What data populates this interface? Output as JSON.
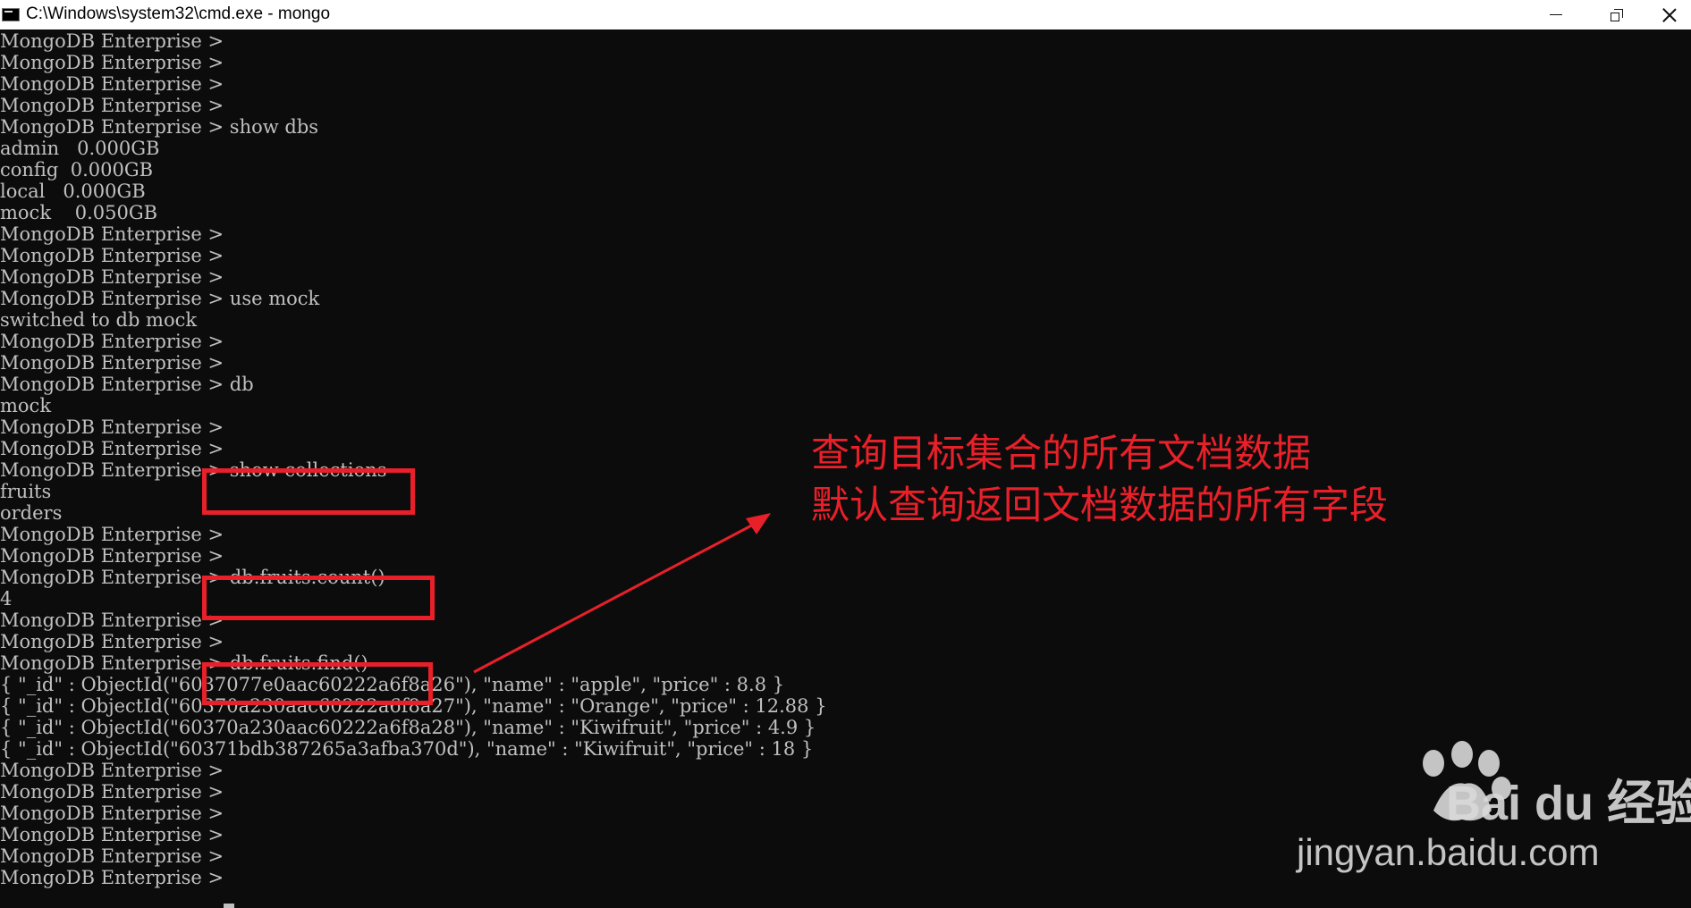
{
  "window": {
    "title": "C:\\Windows\\system32\\cmd.exe - mongo",
    "icon": "console-app-icon",
    "controls": [
      "minimize-icon",
      "restore-icon",
      "close-icon"
    ]
  },
  "console": {
    "lines": [
      "MongoDB Enterprise >",
      "MongoDB Enterprise >",
      "MongoDB Enterprise >",
      "MongoDB Enterprise >",
      "MongoDB Enterprise > show dbs",
      "admin   0.000GB",
      "config  0.000GB",
      "local   0.000GB",
      "mock    0.050GB",
      "MongoDB Enterprise >",
      "MongoDB Enterprise >",
      "MongoDB Enterprise >",
      "MongoDB Enterprise > use mock",
      "switched to db mock",
      "MongoDB Enterprise >",
      "MongoDB Enterprise >",
      "MongoDB Enterprise > db",
      "mock",
      "MongoDB Enterprise >",
      "MongoDB Enterprise >",
      "MongoDB Enterprise > show collections",
      "fruits",
      "orders",
      "MongoDB Enterprise >",
      "MongoDB Enterprise >",
      "MongoDB Enterprise > db.fruits.count()",
      "4",
      "MongoDB Enterprise >",
      "MongoDB Enterprise >",
      "MongoDB Enterprise > db.fruits.find()",
      "{ \"_id\" : ObjectId(\"6037077e0aac60222a6f8a26\"), \"name\" : \"apple\", \"price\" : 8.8 }",
      "{ \"_id\" : ObjectId(\"60370a230aac60222a6f8a27\"), \"name\" : \"Orange\", \"price\" : 12.88 }",
      "{ \"_id\" : ObjectId(\"60370a230aac60222a6f8a28\"), \"name\" : \"Kiwifruit\", \"price\" : 4.9 }",
      "{ \"_id\" : ObjectId(\"60371bdb387265a3afba370d\"), \"name\" : \"Kiwifruit\", \"price\" : 18 }",
      "MongoDB Enterprise >",
      "MongoDB Enterprise >",
      "MongoDB Enterprise >",
      "MongoDB Enterprise >",
      "MongoDB Enterprise >",
      "MongoDB Enterprise >"
    ]
  },
  "annotation": {
    "line1": "查询目标集合的所有文档数据",
    "line2": "默认查询返回文档数据的所有字段",
    "color": "#e8202a"
  },
  "watermark": {
    "brand": "Bai du 经验",
    "url": "jingyan.baidu.com"
  },
  "colors": {
    "console_bg": "#0c0c0c",
    "console_text": "#c0c0c0",
    "highlight": "#e8202a"
  }
}
